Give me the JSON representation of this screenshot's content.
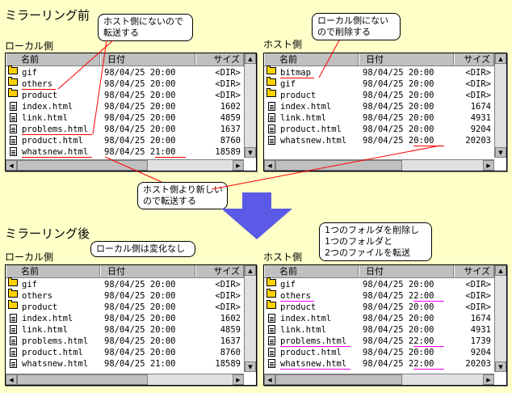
{
  "before": {
    "title": "ミラーリング前",
    "local_label": "ローカル側",
    "host_label": "ホスト側",
    "callout_local": [
      "ホスト側にないので",
      "転送する"
    ],
    "callout_host": [
      "ローカル側にない",
      "ので削除する"
    ],
    "callout_newer": [
      "ホスト側より新しい",
      "ので転送する"
    ]
  },
  "after": {
    "title": "ミラーリング後",
    "local_label": "ローカル側",
    "host_label": "ホスト側",
    "callout_local": [
      "ローカル側は変化なし"
    ],
    "callout_host": [
      "1つのフォルダを削除し",
      "1つのフォルダと",
      "2つのファイルを転送"
    ]
  },
  "columns": {
    "name": "名前",
    "date": "日付",
    "size": "サイズ"
  },
  "colors": {
    "background": "#ffffc8",
    "arrow": "#5a5ae6",
    "highlight_before": "#ff0000",
    "highlight_after": "#ff00ff"
  },
  "panes": {
    "before_local": [
      {
        "type": "folder",
        "name": "gif",
        "date": "98/04/25 20:00",
        "size": "<DIR>"
      },
      {
        "type": "folder",
        "name": "others",
        "date": "98/04/25 20:00",
        "size": "<DIR>"
      },
      {
        "type": "folder",
        "name": "product",
        "date": "98/04/25 20:00",
        "size": "<DIR>"
      },
      {
        "type": "file",
        "name": "index.html",
        "date": "98/04/25 20:00",
        "size": "1602"
      },
      {
        "type": "file",
        "name": "link.html",
        "date": "98/04/25 20:00",
        "size": "4859"
      },
      {
        "type": "file",
        "name": "problems.html",
        "date": "98/04/25 20:00",
        "size": "1637"
      },
      {
        "type": "file",
        "name": "product.html",
        "date": "98/04/25 20:00",
        "size": "8760"
      },
      {
        "type": "file",
        "name": "whatsnew.html",
        "date": "98/04/25 21:00",
        "size": "18589"
      }
    ],
    "before_host": [
      {
        "type": "folder",
        "name": "bitmap",
        "date": "98/04/25 20:00",
        "size": "<DIR>"
      },
      {
        "type": "folder",
        "name": "gif",
        "date": "98/04/25 20:00",
        "size": "<DIR>"
      },
      {
        "type": "folder",
        "name": "product",
        "date": "98/04/25 20:00",
        "size": "<DIR>"
      },
      {
        "type": "file",
        "name": "index.html",
        "date": "98/04/25 20:00",
        "size": "1674"
      },
      {
        "type": "file",
        "name": "link.html",
        "date": "98/04/25 20:00",
        "size": "4931"
      },
      {
        "type": "file",
        "name": "product.html",
        "date": "98/04/25 20:00",
        "size": "9204"
      },
      {
        "type": "file",
        "name": "whatsnew.html",
        "date": "98/04/25 20:00",
        "size": "20203"
      }
    ],
    "after_local": [
      {
        "type": "folder",
        "name": "gif",
        "date": "98/04/25 20:00",
        "size": "<DIR>"
      },
      {
        "type": "folder",
        "name": "others",
        "date": "98/04/25 20:00",
        "size": "<DIR>"
      },
      {
        "type": "folder",
        "name": "product",
        "date": "98/04/25 20:00",
        "size": "<DIR>"
      },
      {
        "type": "file",
        "name": "index.html",
        "date": "98/04/25 20:00",
        "size": "1602"
      },
      {
        "type": "file",
        "name": "link.html",
        "date": "98/04/25 20:00",
        "size": "4859"
      },
      {
        "type": "file",
        "name": "problems.html",
        "date": "98/04/25 20:00",
        "size": "1637"
      },
      {
        "type": "file",
        "name": "product.html",
        "date": "98/04/25 20:00",
        "size": "8760"
      },
      {
        "type": "file",
        "name": "whatsnew.html",
        "date": "98/04/25 21:00",
        "size": "18589"
      }
    ],
    "after_host": [
      {
        "type": "folder",
        "name": "gif",
        "date": "98/04/25 20:00",
        "size": "<DIR>"
      },
      {
        "type": "folder",
        "name": "others",
        "date": "98/04/25 22:00",
        "size": "<DIR>"
      },
      {
        "type": "folder",
        "name": "product",
        "date": "98/04/25 20:00",
        "size": "<DIR>"
      },
      {
        "type": "file",
        "name": "index.html",
        "date": "98/04/25 20:00",
        "size": "1674"
      },
      {
        "type": "file",
        "name": "link.html",
        "date": "98/04/25 20:00",
        "size": "4931"
      },
      {
        "type": "file",
        "name": "problems.html",
        "date": "98/04/25 22:00",
        "size": "1739"
      },
      {
        "type": "file",
        "name": "product.html",
        "date": "98/04/25 20:00",
        "size": "9204"
      },
      {
        "type": "file",
        "name": "whatsnew.html",
        "date": "98/04/25 22:00",
        "size": "20203"
      }
    ]
  }
}
